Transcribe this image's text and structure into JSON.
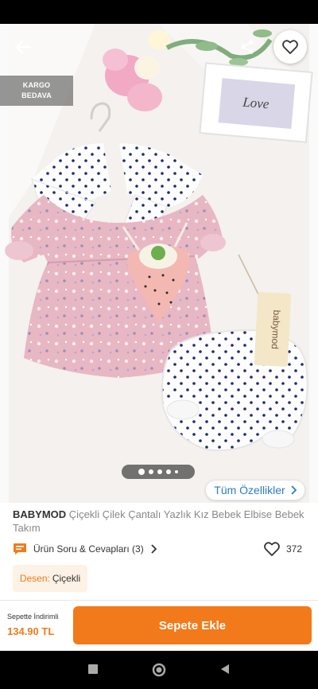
{
  "hero": {
    "kargo_line1": "KARGO",
    "kargo_line2": "BEDAVA",
    "card_text": "Love",
    "tag_brand": "babymod",
    "image_count": 5,
    "active_index": 0
  },
  "actions": {
    "tum_ozellikler": "Tüm Özellikler"
  },
  "product": {
    "brand": "BABYMOD",
    "name": "Çiçekli Çilek Çantalı Yazlık Kız Bebek Elbise Bebek Takım",
    "qa_label": "Ürün Soru & Cevapları (3)",
    "favorite_count": "372",
    "desen_label": "Desen:",
    "desen_value": "Çiçekli"
  },
  "bottom_bar": {
    "price_label": "Sepette İndirimli",
    "price": "134.90 TL",
    "add_to_cart": "Sepete Ekle"
  },
  "colors": {
    "accent": "#f27a1a",
    "link": "#2a7cc7",
    "chip_bg": "#fdf2e6"
  }
}
